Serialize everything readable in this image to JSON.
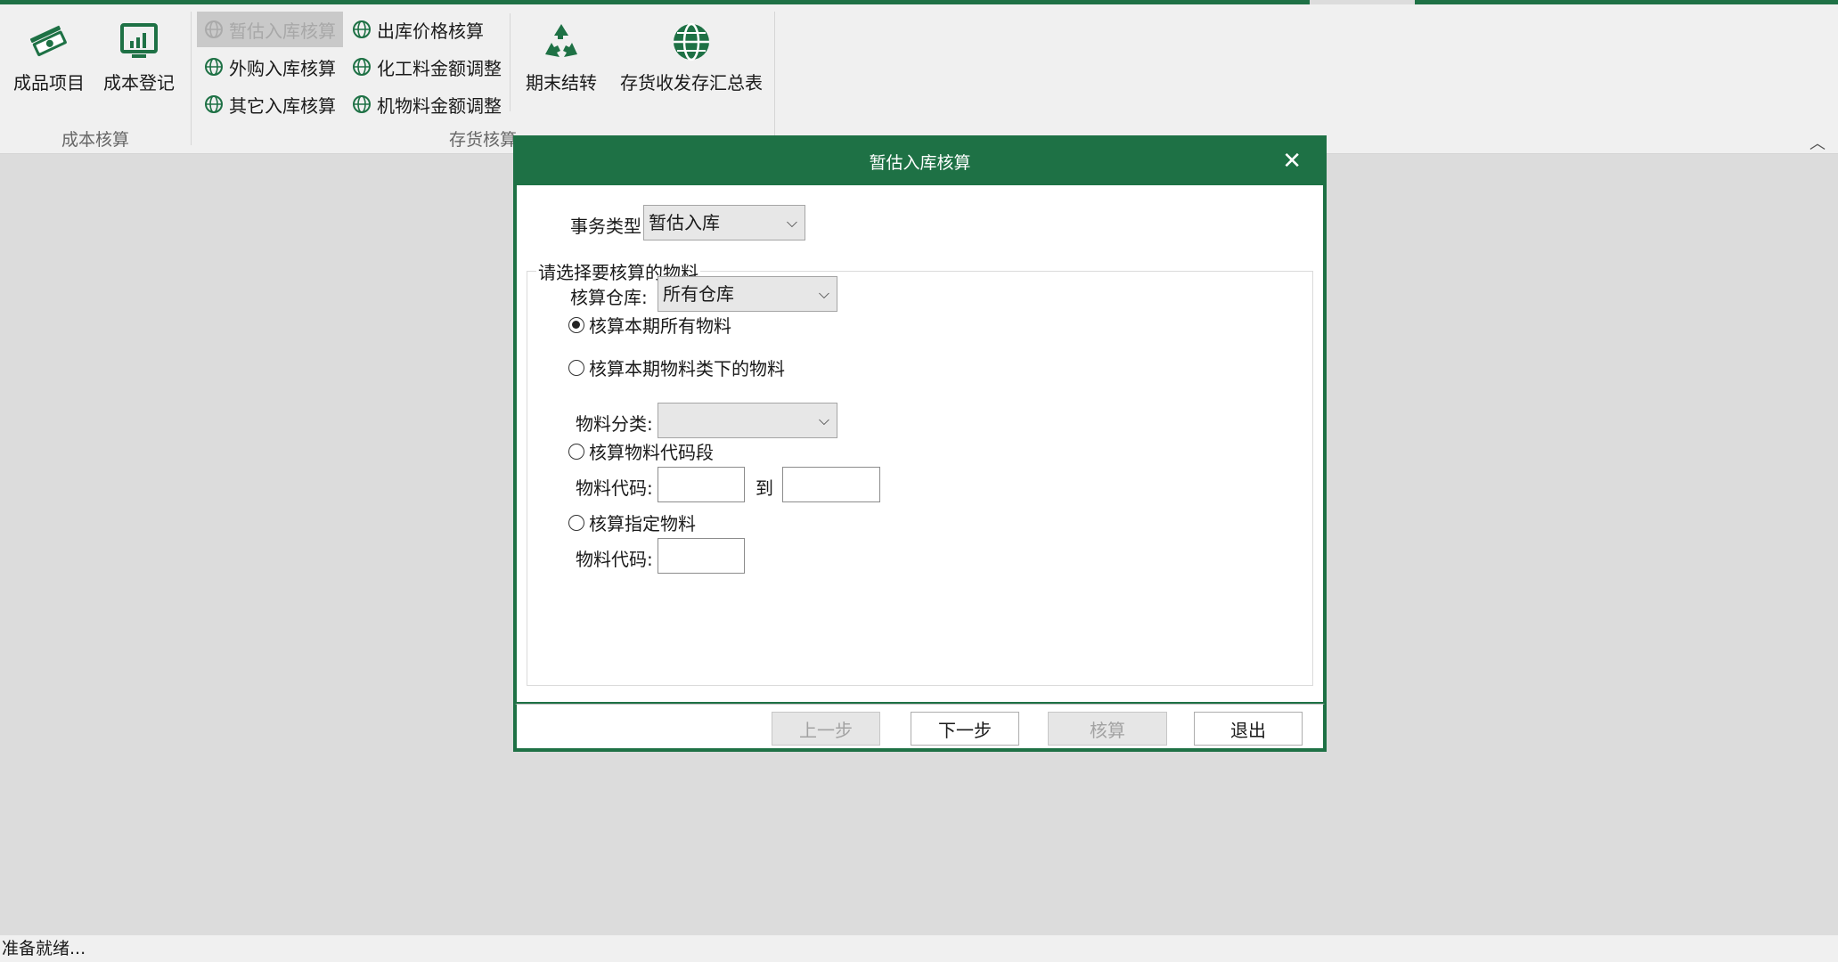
{
  "ribbon": {
    "cost_group": {
      "caption": "成本核算",
      "finished_items": "成品项目",
      "cost_register": "成本登记"
    },
    "stock_group": {
      "caption": "存货核算",
      "temp_receipt": "暂估入库核算",
      "outbound_price": "出库价格核算",
      "purchase_receipt": "外购入库核算",
      "chemical_adjust": "化工料金额调整",
      "other_receipt": "其它入库核算",
      "material_adjust": "机物料金额调整",
      "period_end": "期末结转",
      "summary_report": "存货收发存汇总表"
    }
  },
  "dialog": {
    "title": "暂估入库核算",
    "business_type_label": "事务类型",
    "business_type_value": "暂估入库",
    "group_legend": "请选择要核算的物料",
    "warehouse_label": "核算仓库:",
    "warehouse_value": "所有仓库",
    "radio_all": "核算本期所有物料",
    "radio_category": "核算本期物料类下的物料",
    "category_label": "物料分类:",
    "category_value": "",
    "radio_code_range": "核算物料代码段",
    "code_label_1": "物料代码:",
    "to_label": "到",
    "radio_specific": "核算指定物料",
    "code_label_2": "物料代码:",
    "btn_prev": "上一步",
    "btn_next": "下一步",
    "btn_calc": "核算",
    "btn_exit": "退出"
  },
  "status": {
    "text": "准备就绪..."
  },
  "colors": {
    "accent": "#1e7145"
  }
}
